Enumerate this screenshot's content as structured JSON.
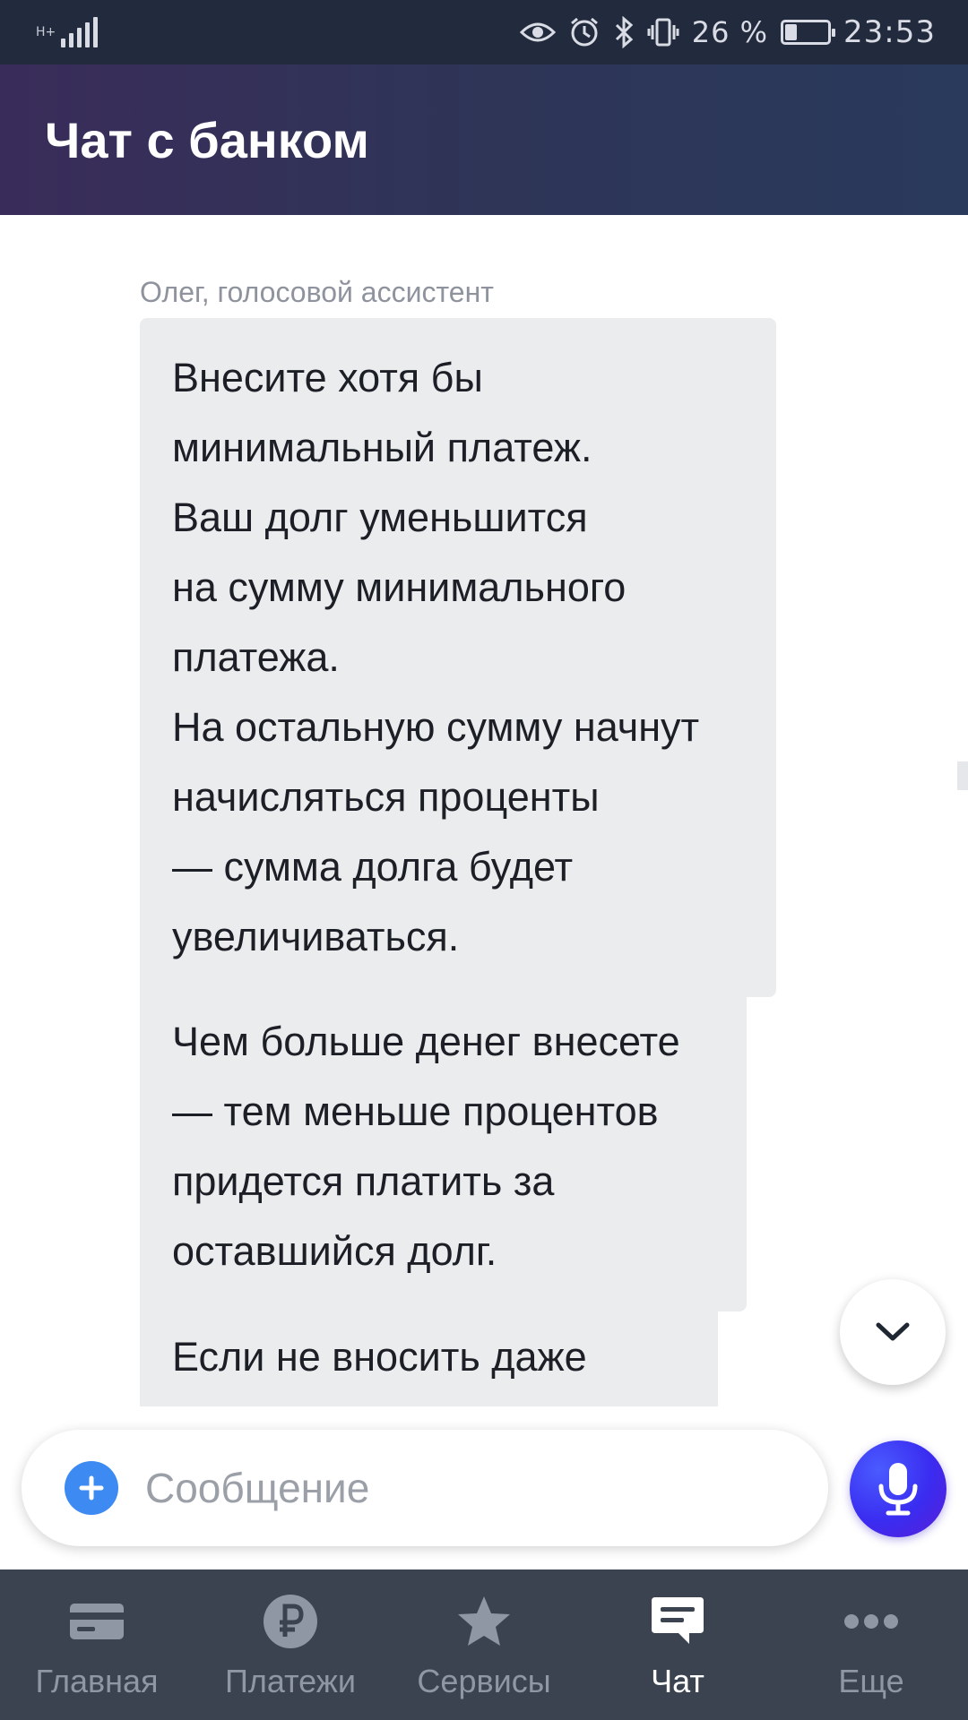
{
  "status_bar": {
    "network": "H+",
    "battery_text": "26 %",
    "battery_level": 0.26,
    "time": "23:53",
    "icons": [
      "eye-icon",
      "alarm-icon",
      "bluetooth-icon",
      "vibrate-icon",
      "battery-icon"
    ]
  },
  "header": {
    "title": "Чат с банком"
  },
  "chat": {
    "sender": "Олег, голосовой ассистент",
    "messages": [
      {
        "text": "Внесите хотя бы\nминимальный платеж.\nВаш долг уменьшится\nна сумму минимального\nплатежа.\nНа остальную сумму начнут\nначисляться проценты\n— сумма долга будет\nувеличиваться."
      },
      {
        "text": "Чем больше денег внесете\n— тем меньше процентов\nпридется платить за\nоставшийся долг."
      },
      {
        "text": "Если не вносить даже\nминимальный"
      }
    ]
  },
  "composer": {
    "placeholder": "Сообщение"
  },
  "nav": {
    "items": [
      {
        "label": "Главная",
        "icon": "card-icon",
        "active": false
      },
      {
        "label": "Платежи",
        "icon": "ruble-icon",
        "active": false
      },
      {
        "label": "Сервисы",
        "icon": "star-icon",
        "active": false
      },
      {
        "label": "Чат",
        "icon": "chat-icon",
        "active": true
      },
      {
        "label": "Еще",
        "icon": "more-icon",
        "active": false
      }
    ]
  },
  "colors": {
    "accent": "#3d8bf2",
    "mic": "#3a2cf0",
    "nav_bg": "#3b4250",
    "bubble_bg": "#ebecee"
  }
}
